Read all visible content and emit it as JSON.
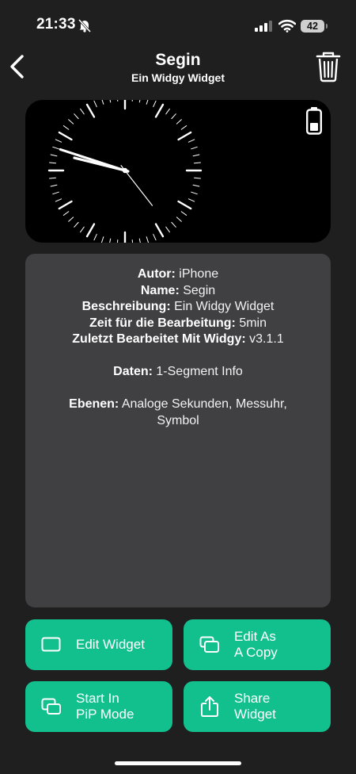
{
  "status_bar": {
    "time": "21:33",
    "battery_level": "42"
  },
  "nav": {
    "title": "Segin",
    "subtitle": "Ein Widgy Widget"
  },
  "info": {
    "author_label": "Autor:",
    "author_value": "iPhone",
    "name_label": "Name:",
    "name_value": "Segin",
    "description_label": "Beschreibung:",
    "description_value": "Ein Widgy Widget",
    "edit_time_label": "Zeit für die Bearbeitung:",
    "edit_time_value": "5min",
    "last_edited_label": "Zuletzt Bearbeitet Mit Widgy:",
    "last_edited_value": "v3.1.1",
    "data_label": "Daten:",
    "data_value": "1-Segment Info",
    "layers_label": "Ebenen:",
    "layers_value": "Analoge Sekunden, Messuhr, Symbol"
  },
  "buttons": {
    "edit_widget": "Edit Widget",
    "edit_as_copy": "Edit As\nA Copy",
    "start_pip": "Start In\nPiP Mode",
    "share_widget": "Share\nWidget"
  },
  "icons": {
    "back": "chevron-left-icon",
    "trash": "trash-icon",
    "edit": "rectangle-icon",
    "copy": "stacked-rectangles-icon",
    "pip": "pip-icon",
    "share": "share-icon",
    "widget_battery": "battery-icon",
    "bell": "bell-slash-icon"
  },
  "colors": {
    "background": "#1f1f1f",
    "card": "#404042",
    "accent": "#12c08e"
  }
}
